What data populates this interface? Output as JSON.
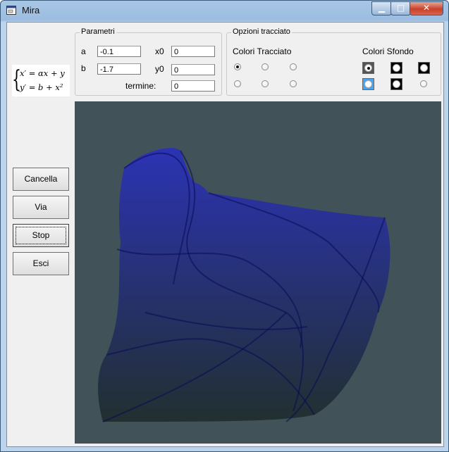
{
  "window": {
    "title": "Mira",
    "minimize_glyph": "▁",
    "maximize_glyph": "□",
    "close_glyph": "✕",
    "app_icon": "window-icon"
  },
  "formula": {
    "line1": "x′ = αx + y",
    "line2": "y′ = b + x²"
  },
  "params": {
    "title": "Parametri",
    "a_label": "a",
    "a_value": "-0.1",
    "b_label": "b",
    "b_value": "-1.7",
    "x0_label": "x0",
    "x0_value": "0",
    "y0_label": "y0",
    "y0_value": "0",
    "termine_label": "termine:",
    "termine_value": "0"
  },
  "options": {
    "title": "Opzioni tracciato",
    "colori_tracciato": "Colori Tracciato",
    "colori_sfondo": "Colori Sfondo",
    "sfondo_colors": [
      "#555555",
      "#000000",
      "#000000",
      "#4aa3f0",
      "#000000",
      "#f0f0f0"
    ]
  },
  "buttons": {
    "cancella": "Cancella",
    "via": "Via",
    "stop": "Stop",
    "esci": "Esci"
  },
  "plot": {
    "background": "#415258",
    "trace_color_top": "#1a1aff",
    "trace_color_bottom": "#07130f"
  }
}
